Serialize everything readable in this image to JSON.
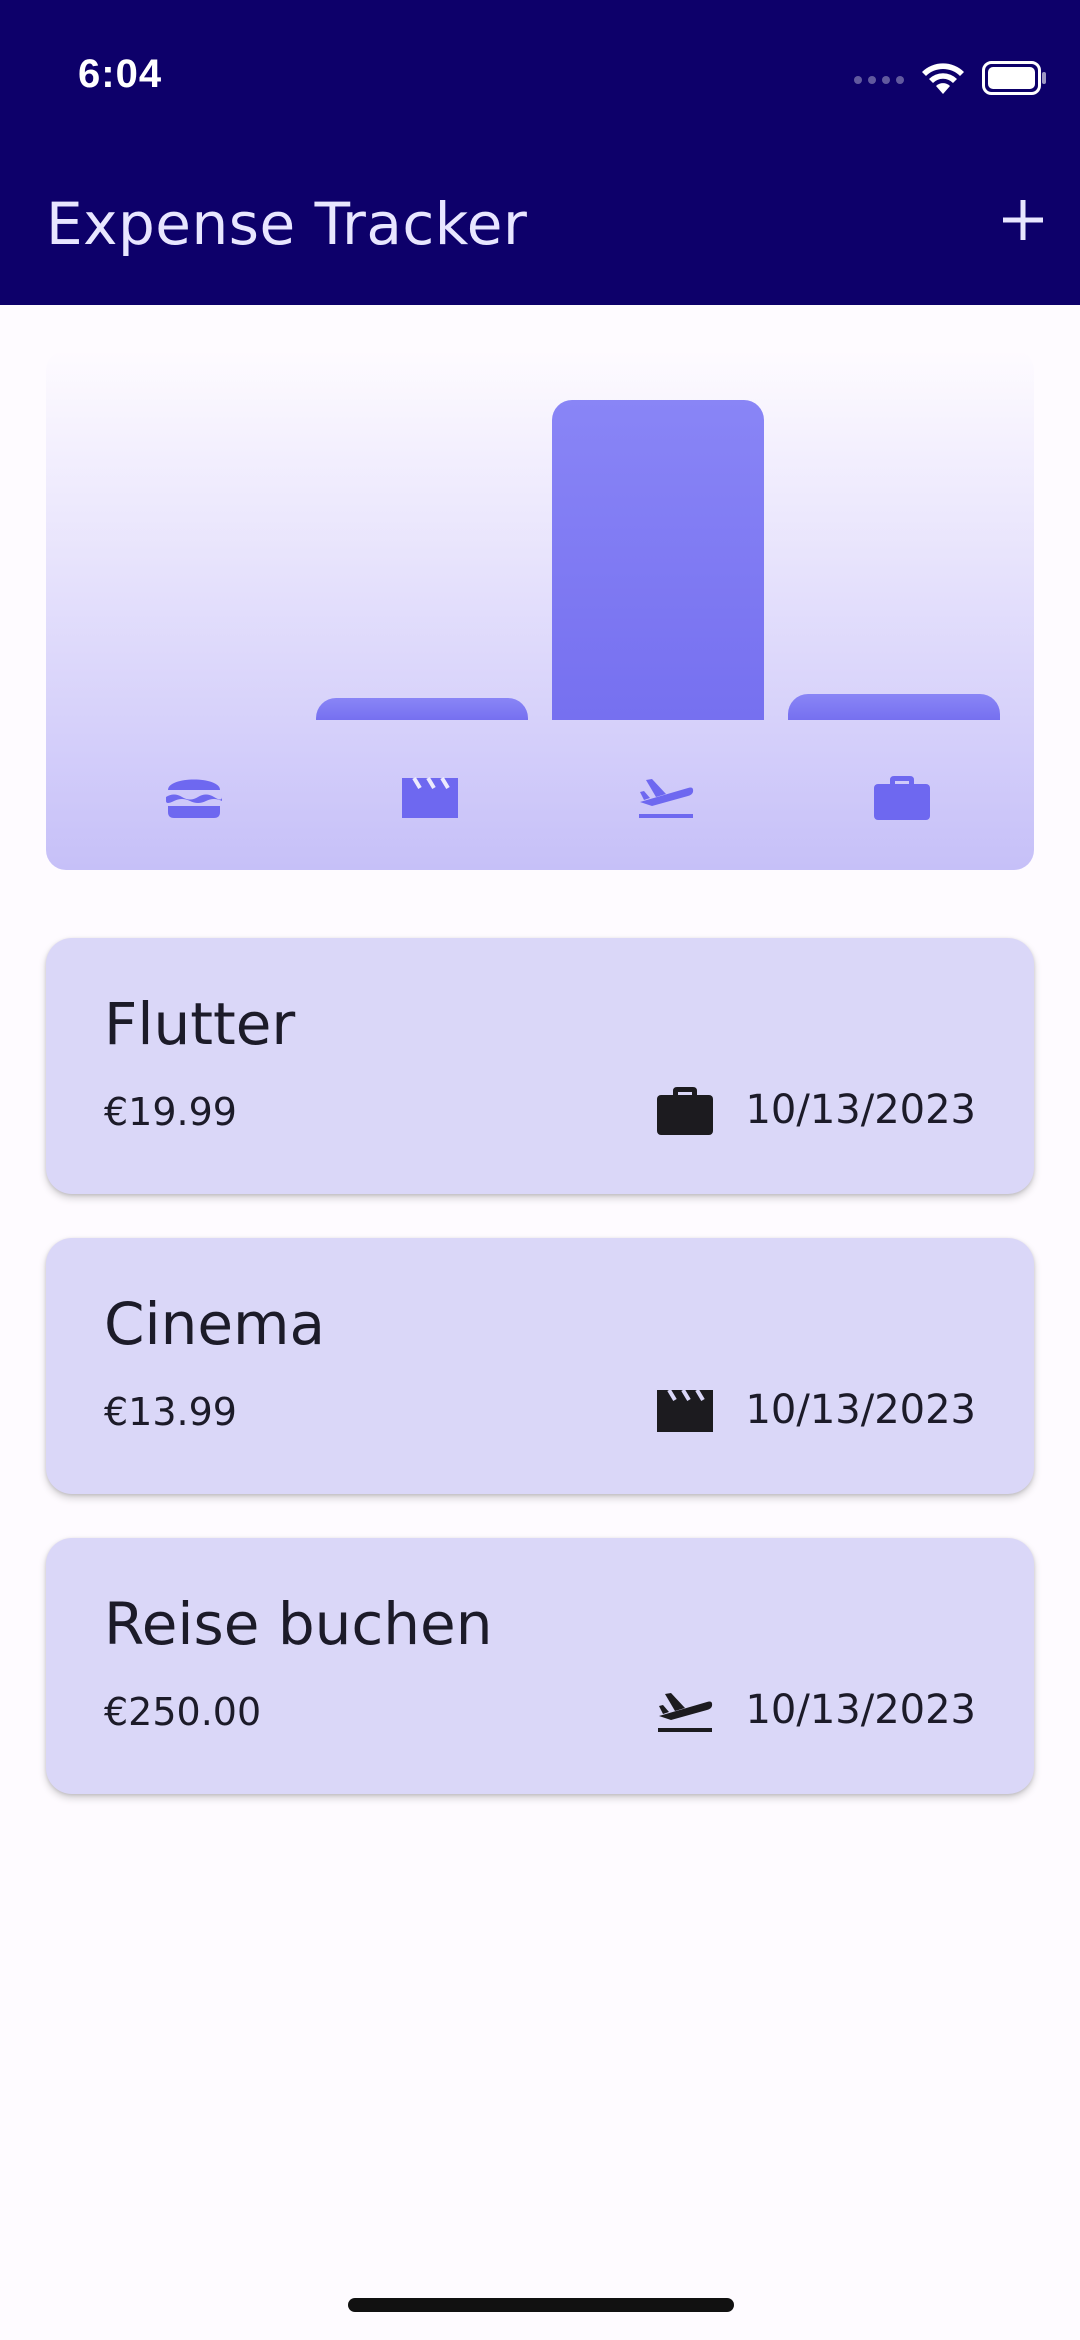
{
  "status_bar": {
    "time": "6:04",
    "icons": [
      "signal-dots-icon",
      "wifi-icon",
      "battery-icon"
    ]
  },
  "app_bar": {
    "title": "Expense Tracker",
    "add_icon": "plus-icon"
  },
  "colors": {
    "app_bar_bg": "#0D006A",
    "chart_bar": "#7A74F2",
    "card_bg": "#DAD7F8",
    "page_bg": "#FEFBFF"
  },
  "chart_data": {
    "type": "bar",
    "categories": [
      "food",
      "leisure",
      "travel",
      "work"
    ],
    "category_icons": [
      "burger-icon",
      "movie-clapper-icon",
      "flight-takeoff-icon",
      "briefcase-icon"
    ],
    "values": [
      0,
      13.99,
      250.0,
      19.99
    ]
  },
  "expenses": [
    {
      "title": "Flutter",
      "amount": "€19.99",
      "date": "10/13/2023",
      "category": "work",
      "icon": "briefcase-icon"
    },
    {
      "title": "Cinema",
      "amount": "€13.99",
      "date": "10/13/2023",
      "category": "leisure",
      "icon": "movie-clapper-icon"
    },
    {
      "title": "Reise buchen",
      "amount": "€250.00",
      "date": "10/13/2023",
      "category": "travel",
      "icon": "flight-takeoff-icon"
    }
  ]
}
